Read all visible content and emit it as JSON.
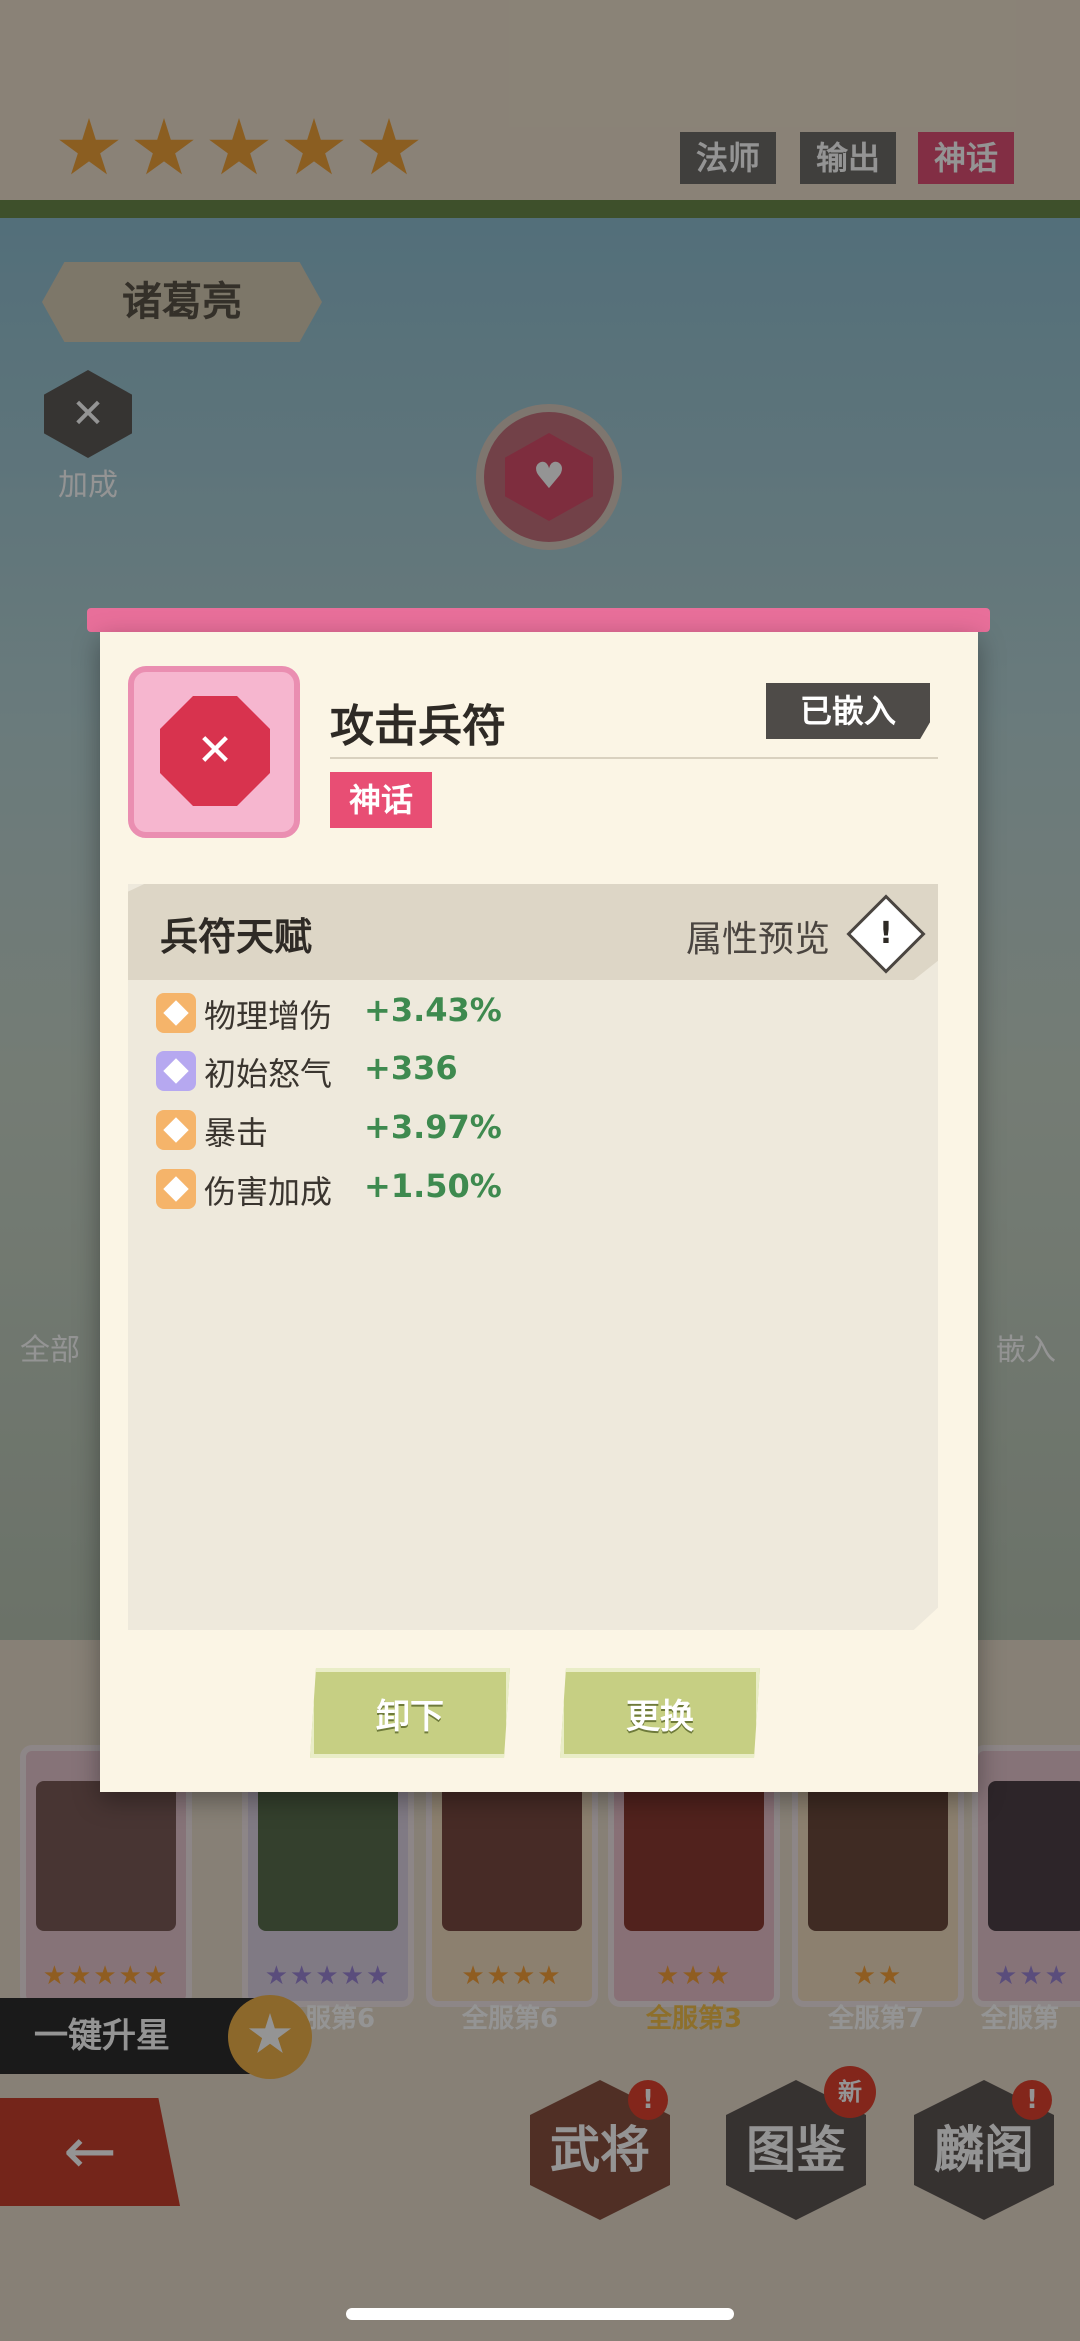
{
  "hero": {
    "stars": 5,
    "tags": [
      "法师",
      "输出",
      "神话"
    ],
    "name": "诸葛亮",
    "bonus_label": "加成"
  },
  "side": {
    "left_label": "全部",
    "right_label": "嵌入"
  },
  "modal": {
    "item_title": "攻击兵符",
    "embedded_label": "已嵌入",
    "rarity": "神话",
    "talent_title": "兵符天赋",
    "preview_label": "属性预览",
    "preview_icon": "!",
    "stats": [
      {
        "name": "物理增伤",
        "value": "+3.43%",
        "icon_color": "#f5b46a"
      },
      {
        "name": "初始怒气",
        "value": "+336",
        "icon_color": "#b6a8f0"
      },
      {
        "name": "暴击",
        "value": "+3.97%",
        "icon_color": "#f5b46a"
      },
      {
        "name": "伤害加成",
        "value": "+1.50%",
        "icon_color": "#f5b46a"
      }
    ],
    "buttons": {
      "unequip": "卸下",
      "replace": "更换"
    }
  },
  "roster": {
    "ranks": [
      "服第6",
      "全服第6",
      "全服第3",
      "全服第7",
      "全服第"
    ],
    "upgrade_label": "一键升星"
  },
  "nav": {
    "wujiang": "武将",
    "tujian": "图鉴",
    "linge": "麟阁",
    "badge": "!",
    "new_badge": "新"
  },
  "colors": {
    "accent_pink": "#e86f9a",
    "rarity_red": "#e84e74",
    "stat_green": "#3e8a4f",
    "button_green": "#c6cf83"
  }
}
